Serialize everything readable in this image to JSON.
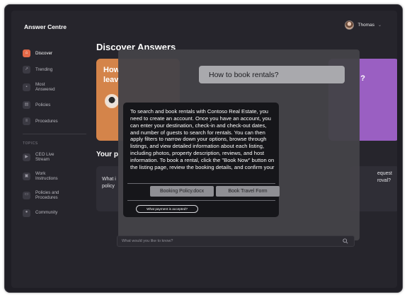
{
  "app": {
    "title": "Answer Centre"
  },
  "user": {
    "name": "Thomas"
  },
  "sidebar": {
    "items": [
      {
        "label": "Discover",
        "active": true
      },
      {
        "label": "Trending"
      },
      {
        "label": "Most\nAnswered"
      },
      {
        "label": "Policies"
      },
      {
        "label": "Procedures"
      }
    ],
    "topics_label": "TOPICS",
    "topics": [
      {
        "label": "CEO Live\nStream"
      },
      {
        "label": "Work\nInstructions"
      },
      {
        "label": "Policies and\nProcedures"
      },
      {
        "label": "Community"
      }
    ]
  },
  "main": {
    "title": "Discover Answers",
    "orange_card_text": "How\nleav",
    "purple_card_text": "?",
    "section_title": "Your p",
    "left_card_text": "What i\npolicy",
    "right_card_text": "equest\nroval?"
  },
  "chat": {
    "query": "How to book rentals?",
    "answer": "To search and book rentals with Contoso Real Estate, you need to create an account. Once you have an account, you can enter your destination, check-in and check-out dates, and number of guests to search for rentals. You can then apply filters to narrow down your options, browse through listings, and view detailed information about each listing, including photos, property description, reviews, and host information. To book a rental, click the \"Book Now\" button on the listing page, review the booking details, and confirm your",
    "sources": [
      "Booking Policy.docx",
      "Book Travel Form"
    ],
    "suggestion": "What payment is accepted?",
    "input_placeholder": "What would you like to know?"
  },
  "colors": {
    "accent": "#e46a49",
    "orange_card": "#d4844a",
    "purple_card": "#9a5fc2",
    "background": "#26252c"
  }
}
